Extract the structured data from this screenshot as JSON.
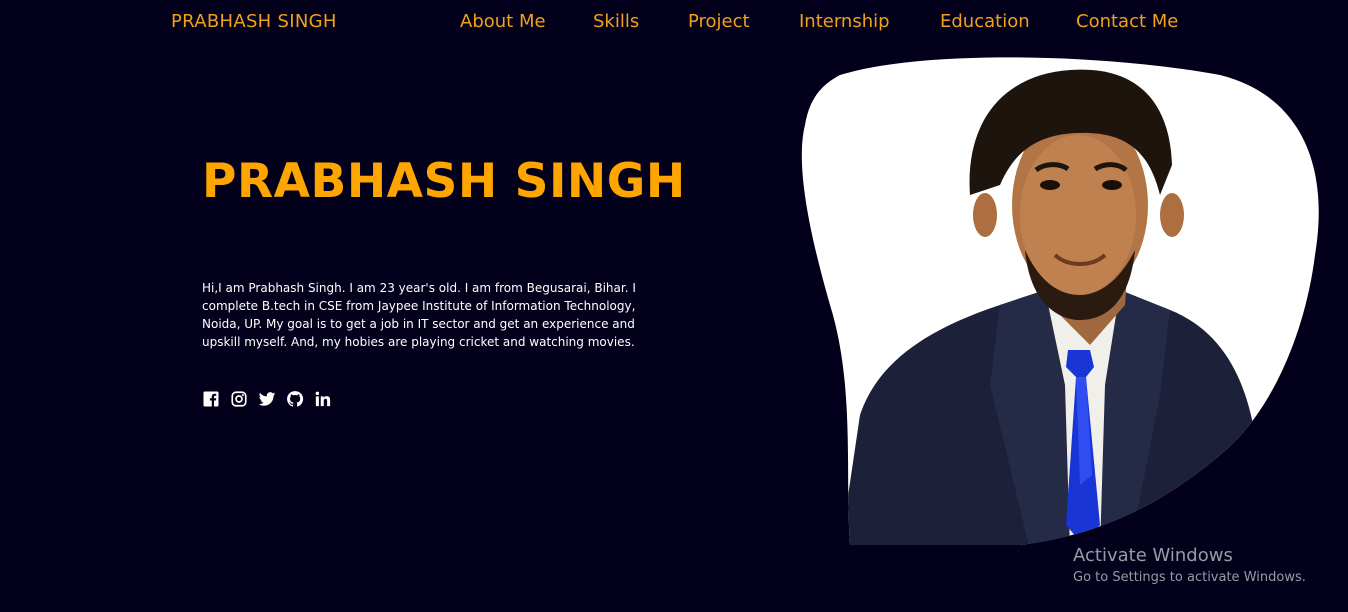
{
  "nav": {
    "brand": "PRABHASH SINGH",
    "links": [
      {
        "label": "About Me"
      },
      {
        "label": "Skills"
      },
      {
        "label": "Project"
      },
      {
        "label": "Internship"
      },
      {
        "label": "Education"
      },
      {
        "label": "Contact Me"
      }
    ]
  },
  "hero": {
    "title": "PRABHASH SINGH",
    "bio": "Hi,I am Prabhash Singh. I am 23 year's old. I am from Begusarai, Bihar. I complete B.tech in CSE from Jaypee Institute of Information Technology, Noida, UP. My goal is to get a job in IT sector and get an experience and upskill myself. And, my hobies are playing cricket and watching movies."
  },
  "socials": [
    {
      "icon": "facebook-icon"
    },
    {
      "icon": "instagram-icon"
    },
    {
      "icon": "twitter-icon"
    },
    {
      "icon": "github-icon"
    },
    {
      "icon": "linkedin-icon"
    }
  ],
  "watermark": {
    "title": "Activate Windows",
    "subtitle": "Go to Settings to activate Windows."
  },
  "colors": {
    "background": "#03001b",
    "accent": "#ffa500",
    "nav_text": "#f0a11b",
    "body_text": "#ffffff"
  }
}
